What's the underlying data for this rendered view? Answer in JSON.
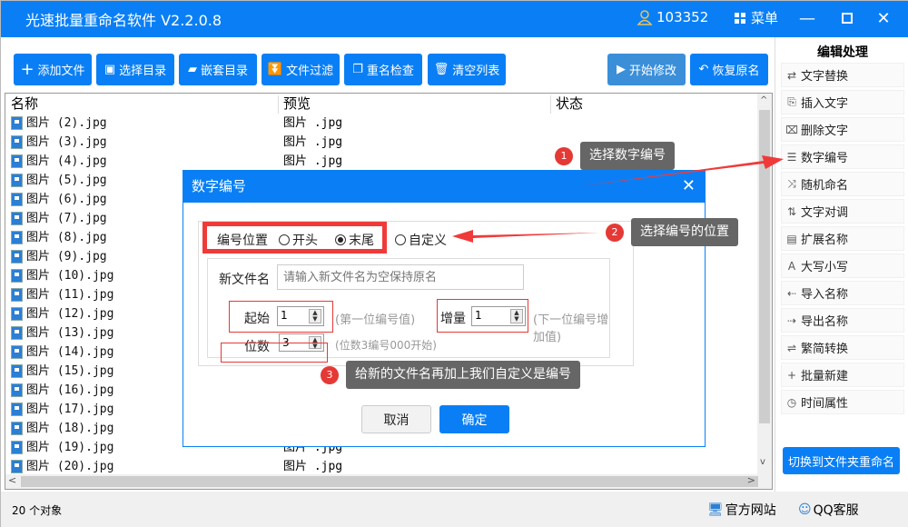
{
  "app": {
    "title": "光速批量重命名软件 V2.2.0.8",
    "user_id": "103352",
    "menu_label": "菜单"
  },
  "toolbar": {
    "add_files": "添加文件",
    "select_dir": "选择目录",
    "nested_dir": "嵌套目录",
    "file_filter": "文件过滤",
    "rename_check": "重名检查",
    "clear_list": "清空列表",
    "start_modify": "开始修改",
    "restore_names": "恢复原名"
  },
  "list": {
    "headers": {
      "name": "名称",
      "preview": "预览",
      "status": "状态"
    },
    "rows": [
      {
        "name": "图片 (2).jpg",
        "preview": "图片 .jpg"
      },
      {
        "name": "图片 (3).jpg",
        "preview": "图片 .jpg"
      },
      {
        "name": "图片 (4).jpg",
        "preview": "图片 .jpg"
      },
      {
        "name": "图片 (5).jpg",
        "preview": ""
      },
      {
        "name": "图片 (6).jpg",
        "preview": ""
      },
      {
        "name": "图片 (7).jpg",
        "preview": ""
      },
      {
        "name": "图片 (8).jpg",
        "preview": ""
      },
      {
        "name": "图片 (9).jpg",
        "preview": ""
      },
      {
        "name": "图片 (10).jpg",
        "preview": ""
      },
      {
        "name": "图片 (11).jpg",
        "preview": ""
      },
      {
        "name": "图片 (12).jpg",
        "preview": ""
      },
      {
        "name": "图片 (13).jpg",
        "preview": ""
      },
      {
        "name": "图片 (14).jpg",
        "preview": ""
      },
      {
        "name": "图片 (15).jpg",
        "preview": ""
      },
      {
        "name": "图片 (16).jpg",
        "preview": ""
      },
      {
        "name": "图片 (17).jpg",
        "preview": ""
      },
      {
        "name": "图片 (18).jpg",
        "preview": ""
      },
      {
        "name": "图片 (19).jpg",
        "preview": "图片 .jpg"
      },
      {
        "name": "图片 (20).jpg",
        "preview": "图片 .jpg"
      }
    ]
  },
  "status": {
    "count": "20 个对象",
    "website": "官方网站",
    "qq": "QQ客服"
  },
  "sidebar": {
    "title": "编辑处理",
    "items": [
      {
        "label": "文字替换",
        "icon": "⇄"
      },
      {
        "label": "插入文字",
        "icon": "⎘"
      },
      {
        "label": "删除文字",
        "icon": "⌧"
      },
      {
        "label": "数字编号",
        "icon": "☰"
      },
      {
        "label": "随机命名",
        "icon": "⤨"
      },
      {
        "label": "文字对调",
        "icon": "⇅"
      },
      {
        "label": "扩展名称",
        "icon": "▤"
      },
      {
        "label": "大写小写",
        "icon": "A"
      },
      {
        "label": "导入名称",
        "icon": "⇠"
      },
      {
        "label": "导出名称",
        "icon": "⇢"
      },
      {
        "label": "繁简转换",
        "icon": "⇌"
      },
      {
        "label": "批量新建",
        "icon": "+"
      },
      {
        "label": "时间属性",
        "icon": "◷"
      }
    ],
    "switch_button": "切换到文件夹重命名"
  },
  "dialog": {
    "title": "数字编号",
    "position_label": "编号位置",
    "opt_start": "开头",
    "opt_end": "末尾",
    "opt_custom": "自定义",
    "selected": "末尾",
    "newname_label": "新文件名",
    "newname_placeholder": "请输入新文件名为空保持原名",
    "start_label": "起始",
    "start_value": "1",
    "start_hint": "(第一位编号值)",
    "step_label": "增量",
    "step_value": "1",
    "step_hint": "(下一位编号增加值)",
    "digits_label": "位数",
    "digits_value": "3",
    "digits_hint": "(位数3编号000开始)",
    "cancel": "取消",
    "ok": "确定"
  },
  "annotations": [
    {
      "num": "1",
      "text": "选择数字编号"
    },
    {
      "num": "2",
      "text": "选择编号的位置"
    },
    {
      "num": "3",
      "text": "给新的文件名再加上我们自定义是编号"
    }
  ],
  "colors": {
    "accent": "#0a7ff5",
    "annotation_red": "#f03a3a",
    "tooltip": "#666666"
  }
}
